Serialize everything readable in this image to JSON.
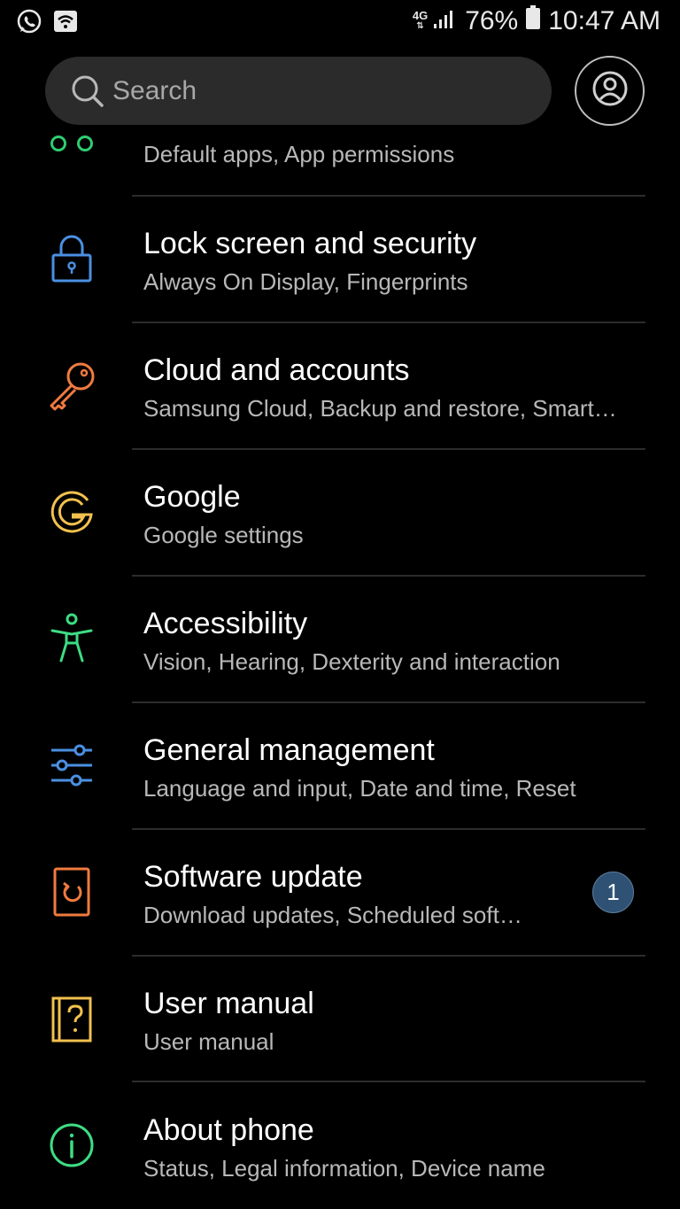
{
  "status_bar": {
    "network_type": "4G",
    "battery_percent": "76%",
    "time": "10:47 AM",
    "icons": [
      "whatsapp-icon",
      "wifi-notification-icon",
      "signal-icon",
      "battery-icon"
    ]
  },
  "search": {
    "placeholder": "Search"
  },
  "settings": {
    "items": [
      {
        "title": "",
        "subtitle": "Default apps, App permissions",
        "icon": "apps-icon",
        "color": "#2ecc71"
      },
      {
        "title": "Lock screen and security",
        "subtitle": "Always On Display, Fingerprints",
        "icon": "lock-icon",
        "color": "#4a90e2"
      },
      {
        "title": "Cloud and accounts",
        "subtitle": "Samsung Cloud, Backup and restore, Smart…",
        "icon": "key-icon",
        "color": "#f07b3f"
      },
      {
        "title": "Google",
        "subtitle": "Google settings",
        "icon": "google-icon",
        "color": "#f2c14e"
      },
      {
        "title": "Accessibility",
        "subtitle": "Vision, Hearing, Dexterity and interaction",
        "icon": "accessibility-icon",
        "color": "#3ddc84"
      },
      {
        "title": "General management",
        "subtitle": "Language and input, Date and time, Reset",
        "icon": "sliders-icon",
        "color": "#4a90e2"
      },
      {
        "title": "Software update",
        "subtitle": "Download updates, Scheduled soft…",
        "icon": "software-update-icon",
        "color": "#f07b3f",
        "badge": "1"
      },
      {
        "title": "User manual",
        "subtitle": "User manual",
        "icon": "help-book-icon",
        "color": "#f2c14e"
      },
      {
        "title": "About phone",
        "subtitle": "Status, Legal information, Device name",
        "icon": "info-icon",
        "color": "#3ddc84"
      }
    ]
  }
}
